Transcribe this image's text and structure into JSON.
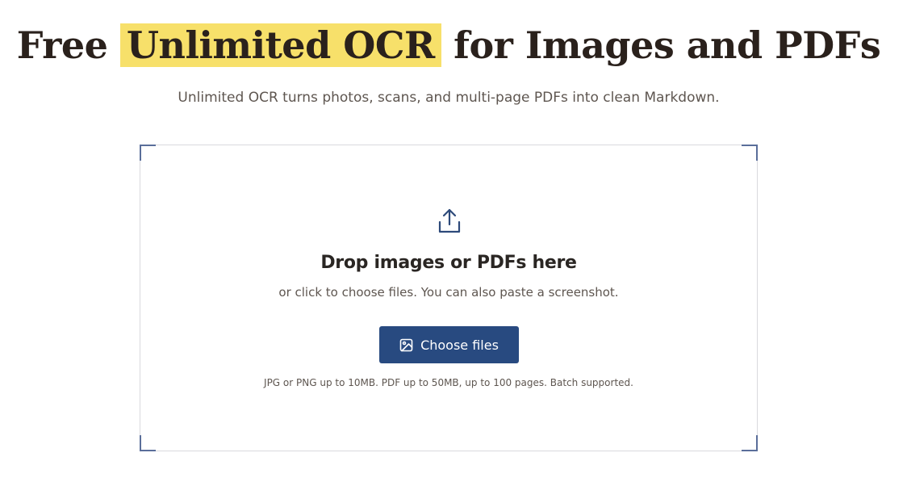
{
  "hero": {
    "title_before": "Free ",
    "title_highlight": "Unlimited OCR",
    "title_after": " for Images and PDFs",
    "subtitle": "Unlimited OCR turns photos, scans, and multi-page PDFs into clean Markdown."
  },
  "dropzone": {
    "icon": "upload-icon",
    "title": "Drop images or PDFs here",
    "subtitle": "or click to choose files. You can also paste a screenshot.",
    "button_icon": "image-icon",
    "button_label": "Choose files",
    "note": "JPG or PNG up to 10MB. PDF up to 50MB, up to 100 pages. Batch supported."
  },
  "colors": {
    "highlight": "#f7e06a",
    "accent": "#284a80",
    "corner": "#5a6e9a",
    "text_dark": "#2a211c",
    "text_muted": "#5e5650"
  }
}
